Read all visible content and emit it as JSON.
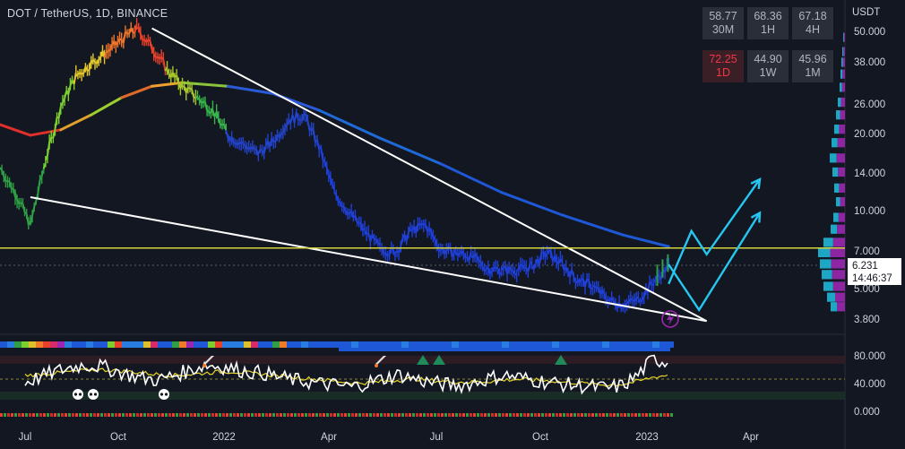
{
  "header": {
    "symbol_title": "DOT / TetherUS, 1D, BINANCE"
  },
  "rsi_table": [
    {
      "value": "58.77",
      "tf": "30M",
      "hot": false
    },
    {
      "value": "68.36",
      "tf": "1H",
      "hot": false
    },
    {
      "value": "67.18",
      "tf": "4H",
      "hot": false
    },
    {
      "value": "72.25",
      "tf": "1D",
      "hot": true
    },
    {
      "value": "44.90",
      "tf": "1W",
      "hot": false
    },
    {
      "value": "45.96",
      "tf": "1M",
      "hot": false
    }
  ],
  "price_scale": {
    "unit": "USDT",
    "ticks": [
      "50.000",
      "38.000",
      "26.000",
      "20.000",
      "14.000",
      "10.000",
      "7.000",
      "5.000",
      "3.800"
    ]
  },
  "current_price": {
    "price": "6.231",
    "countdown": "14:46:37"
  },
  "oscillator_scale": {
    "ticks": [
      "80.000",
      "40.000",
      "0.000"
    ]
  },
  "time_axis": {
    "labels": [
      "Jul",
      "Oct",
      "2022",
      "Apr",
      "Jul",
      "Oct",
      "2023",
      "Apr"
    ]
  },
  "colors": {
    "background": "#131722",
    "trendline": "#ffffff",
    "horizontal_level": "#d4d43a",
    "projection": "#26c6f0",
    "ma_line": "#1e58d6",
    "oscillator": "#ffffff",
    "oscillator_signal": "#e6d42a",
    "icon_accent": "#9c27b0"
  },
  "chart_data": [
    {
      "type": "line",
      "title": "DOT / TetherUS, 1D, BINANCE",
      "x_labels": [
        "Jul",
        "Oct",
        "2022",
        "Apr",
        "Jul",
        "Oct",
        "2023",
        "Apr"
      ],
      "y_scale": "log",
      "ylim": [
        3.6,
        58
      ],
      "yticks": [
        50,
        38,
        26,
        20,
        14,
        10,
        7,
        5,
        3.8
      ],
      "series": [
        {
          "values_approx": [
            [
              0.0,
              15.0
            ],
            [
              0.02,
              12.0
            ],
            [
              0.04,
              9.0
            ],
            [
              0.06,
              16.0
            ],
            [
              0.08,
              26.0
            ],
            [
              0.1,
              34.0
            ],
            [
              0.12,
              38.0
            ],
            [
              0.14,
              42.0
            ],
            [
              0.16,
              47.0
            ],
            [
              0.18,
              52.0
            ],
            [
              0.2,
              44.0
            ],
            [
              0.22,
              36.0
            ],
            [
              0.24,
              31.0
            ],
            [
              0.26,
              28.0
            ],
            [
              0.28,
              25.0
            ],
            [
              0.3,
              20.0
            ],
            [
              0.32,
              18.5
            ],
            [
              0.34,
              17.0
            ],
            [
              0.36,
              19.0
            ],
            [
              0.38,
              23.0
            ],
            [
              0.4,
              24.0
            ],
            [
              0.42,
              18.0
            ],
            [
              0.44,
              12.0
            ],
            [
              0.46,
              10.0
            ],
            [
              0.48,
              8.5
            ],
            [
              0.5,
              7.3
            ],
            [
              0.52,
              7.0
            ],
            [
              0.54,
              8.5
            ],
            [
              0.56,
              9.0
            ],
            [
              0.58,
              7.2
            ],
            [
              0.6,
              7.0
            ],
            [
              0.62,
              6.8
            ],
            [
              0.64,
              6.1
            ],
            [
              0.66,
              6.0
            ],
            [
              0.68,
              6.0
            ],
            [
              0.7,
              6.2
            ],
            [
              0.72,
              7.0
            ],
            [
              0.74,
              6.3
            ],
            [
              0.76,
              5.5
            ],
            [
              0.78,
              5.2
            ],
            [
              0.8,
              4.6
            ],
            [
              0.82,
              4.4
            ],
            [
              0.84,
              4.6
            ],
            [
              0.86,
              5.4
            ],
            [
              0.88,
              6.2
            ]
          ]
        }
      ],
      "trendlines": [
        {
          "from": [
            0.04,
            11.5
          ],
          "to": [
            0.93,
            3.8
          ]
        },
        {
          "from": [
            0.2,
            52.0
          ],
          "to": [
            0.93,
            3.8
          ]
        }
      ],
      "horizontal_level": 7.3,
      "projections": [
        {
          "points": [
            [
              0.88,
              5.3
            ],
            [
              0.91,
              8.5
            ],
            [
              0.93,
              6.9
            ],
            [
              1.0,
              13.5
            ]
          ]
        },
        {
          "points": [
            [
              0.88,
              6.3
            ],
            [
              0.92,
              4.2
            ],
            [
              1.0,
              10.0
            ]
          ]
        }
      ]
    },
    {
      "type": "line",
      "title": "",
      "ylim": [
        0,
        100
      ],
      "yticks": [
        80,
        40,
        0
      ],
      "series": [
        {
          "values_approx": [
            45,
            52,
            60,
            66,
            70,
            68,
            62,
            55,
            50,
            48,
            55,
            62,
            70,
            68,
            64,
            60,
            58,
            52,
            48,
            45,
            42,
            40,
            38,
            45,
            50,
            56,
            50,
            45,
            42,
            40,
            44,
            50,
            55,
            52,
            48,
            45,
            42,
            40,
            38,
            36,
            40,
            55,
            78,
            74
          ]
        },
        {
          "values_approx": [
            55,
            56,
            58,
            60,
            62,
            63,
            62,
            60,
            58,
            56,
            55,
            56,
            58,
            60,
            60,
            58,
            56,
            54,
            52,
            50,
            48,
            46,
            44,
            44,
            46,
            48,
            50,
            48,
            46,
            45,
            45,
            46,
            48,
            49,
            48,
            47,
            45,
            44,
            42,
            41,
            42,
            46,
            52,
            55
          ]
        }
      ]
    }
  ]
}
